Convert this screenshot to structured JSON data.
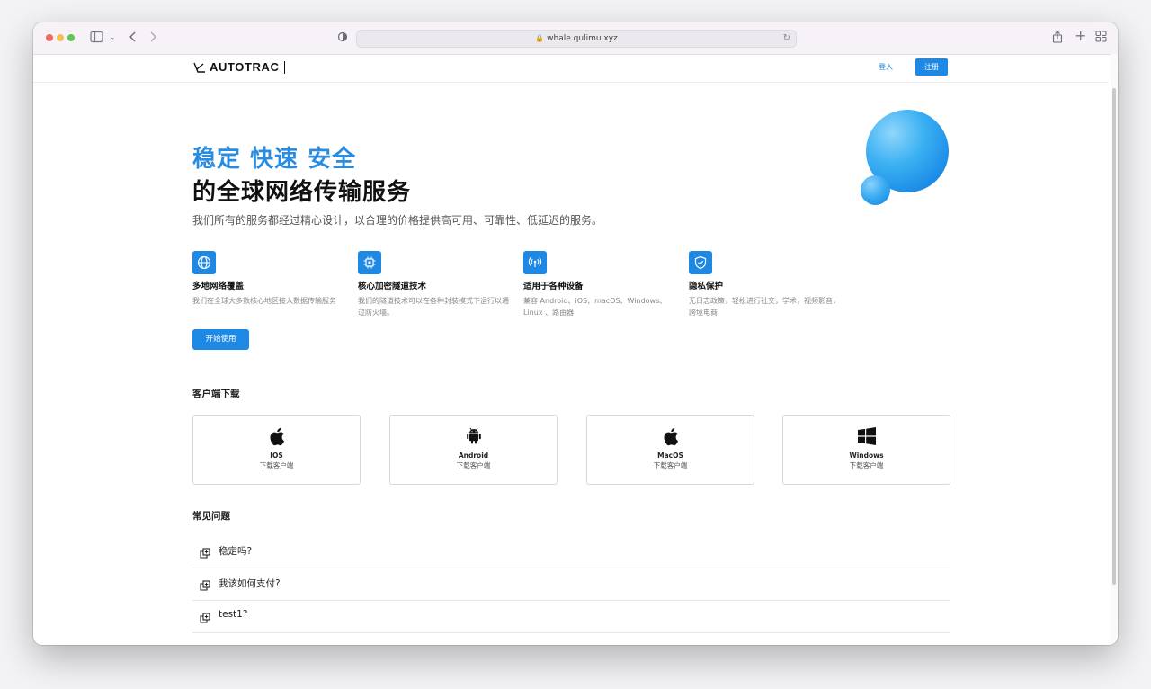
{
  "browser": {
    "url": "whale.qulimu.xyz"
  },
  "header": {
    "logo_text": "AUTOTRAC",
    "login_label": "登入",
    "register_label": "注册"
  },
  "hero": {
    "headline_blue": "稳定 快速 安全",
    "headline_black": "的全球网络传输服务",
    "subtitle": "我们所有的服务都经过精心设计，以合理的价格提供高可用、可靠性、低延迟的服务。",
    "cta_label": "开始使用"
  },
  "features": [
    {
      "icon": "globe-icon",
      "title": "多地网络覆盖",
      "desc": "我们在全球大多数核心地区接入数据传输服务"
    },
    {
      "icon": "chip-icon",
      "title": "核心加密隧道技术",
      "desc": "我们的隧道技术可以在各种封装模式下运行以通过防火墙。"
    },
    {
      "icon": "broadcast-icon",
      "title": "适用于各种设备",
      "desc": "兼容 Android、iOS、macOS、Windows、Linux 、路由器"
    },
    {
      "icon": "shield-icon",
      "title": "隐私保护",
      "desc": "无日志政策，轻松进行社交，学术，视频影音，跨境电商"
    }
  ],
  "downloads": {
    "title": "客户端下载",
    "items": [
      {
        "icon": "apple-icon",
        "name": "IOS",
        "sub": "下载客户端"
      },
      {
        "icon": "android-icon",
        "name": "Android",
        "sub": "下载客户端"
      },
      {
        "icon": "apple-icon",
        "name": "MacOS",
        "sub": "下载客户端"
      },
      {
        "icon": "windows-icon",
        "name": "Windows",
        "sub": "下载客户端"
      }
    ]
  },
  "faq": {
    "title": "常见问题",
    "items": [
      {
        "question": "稳定吗?"
      },
      {
        "question": "我该如何支付?"
      },
      {
        "question": "test1?"
      }
    ]
  },
  "colors": {
    "accent": "#1e88e5",
    "headline_blue": "#2a8ce0"
  }
}
